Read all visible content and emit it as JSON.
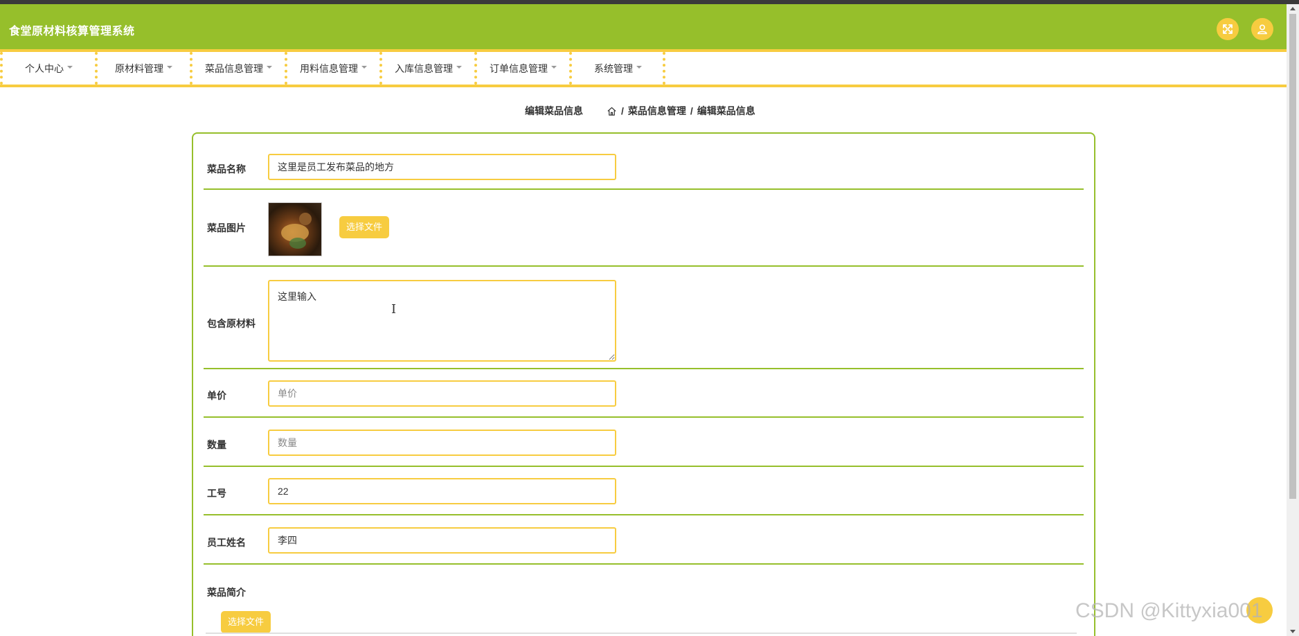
{
  "app": {
    "title": "食堂原材料核算管理系统"
  },
  "header": {
    "fullscreen_icon": "expand-icon",
    "user_icon": "user-icon"
  },
  "nav": {
    "items": [
      {
        "label": "个人中心"
      },
      {
        "label": "原材料管理"
      },
      {
        "label": "菜品信息管理"
      },
      {
        "label": "用料信息管理"
      },
      {
        "label": "入库信息管理"
      },
      {
        "label": "订单信息管理"
      },
      {
        "label": "系统管理"
      }
    ]
  },
  "page": {
    "title": "编辑菜品信息",
    "breadcrumb": {
      "home_icon": "home-icon",
      "sep": "/",
      "level1": "菜品信息管理",
      "level2": "编辑菜品信息"
    }
  },
  "form": {
    "name": {
      "label": "菜品名称",
      "value": "这里是员工发布菜品的地方"
    },
    "image": {
      "label": "菜品图片",
      "button": "选择文件"
    },
    "materials": {
      "label": "包含原材料",
      "value": "这里输入"
    },
    "price": {
      "label": "单价",
      "placeholder": "单价"
    },
    "quantity": {
      "label": "数量",
      "placeholder": "数量"
    },
    "staff_no": {
      "label": "工号",
      "value": "22"
    },
    "staff_name": {
      "label": "员工姓名",
      "value": "李四"
    },
    "intro": {
      "label": "菜品简介",
      "button": "选择文件"
    }
  },
  "watermark": "CSDN @Kittyxia001",
  "colors": {
    "primary_green": "#96bf2b",
    "accent_yellow": "#f7cc40"
  }
}
